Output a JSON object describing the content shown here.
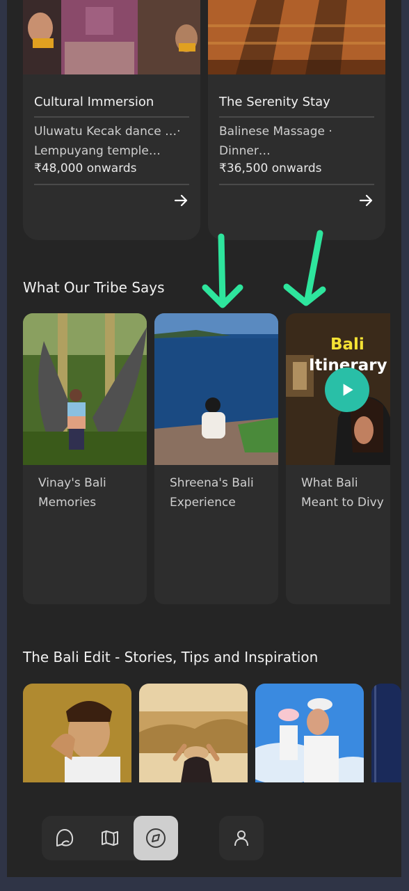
{
  "packages": [
    {
      "title": "Cultural Immersion",
      "desc": "Uluwatu Kecak dance …· Lempuyang temple…",
      "price": "₹48,000 onwards"
    },
    {
      "title": "The Serenity Stay",
      "desc": "Balinese Massage · Dinner…",
      "price": "₹36,500 onwards"
    }
  ],
  "tribe": {
    "title": "What Our Tribe Says",
    "cards": [
      {
        "caption_line1": "Vinay's Bali",
        "caption_line2": "Memories"
      },
      {
        "caption_line1": "Shreena's Bali",
        "caption_line2": "Experience"
      },
      {
        "caption_line1": "What Bali",
        "caption_line2": "Meant to Divy",
        "overlay_line1": "Bali",
        "overlay_line2": "Itinerary"
      }
    ]
  },
  "edit": {
    "title": "The Bali Edit - Stories, Tips and Inspiration"
  },
  "nav": {
    "items": [
      {
        "icon": "chat-icon"
      },
      {
        "icon": "map-icon"
      },
      {
        "icon": "compass-icon",
        "active": true
      },
      {
        "icon": "profile-icon"
      }
    ]
  },
  "colors": {
    "accent_arrow": "#2ee59d",
    "play_button": "#29bfa7"
  }
}
